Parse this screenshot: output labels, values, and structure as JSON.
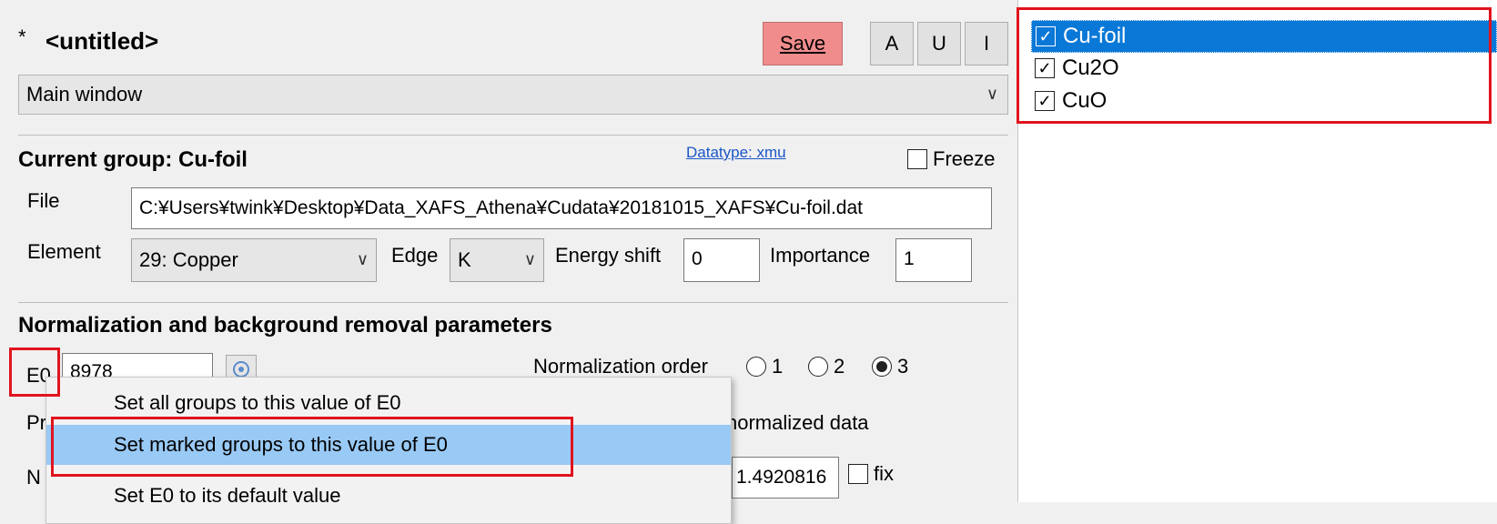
{
  "header": {
    "modified_mark": "*",
    "title": "<untitled>",
    "save_label": "Save",
    "btn_a": "A",
    "btn_u": "U",
    "btn_i": "I"
  },
  "main_select": {
    "value": "Main window"
  },
  "current_group": {
    "heading": "Current group:  Cu-foil",
    "datatype_link": "Datatype: xmu",
    "freeze_label": "Freeze",
    "file_label": "File",
    "file_path": "C:¥Users¥twink¥Desktop¥Data_XAFS_Athena¥Cudata¥20181015_XAFS¥Cu-foil.dat",
    "element_label": "Element",
    "element_value": "29: Copper",
    "edge_label": "Edge",
    "edge_value": "K",
    "energy_shift_label": "Energy shift",
    "energy_shift_value": "0",
    "importance_label": "Importance",
    "importance_value": "1"
  },
  "norm": {
    "heading": "Normalization and background removal parameters",
    "e0_label": "E0",
    "e0_value": "8978",
    "norm_order_label": "Normalization order",
    "order_options": [
      "1",
      "2",
      "3"
    ],
    "order_selected": "3",
    "pre_partial": "Pr",
    "normalized_partial": "normalized data",
    "n_partial": "N",
    "edge_step_value": "1.4920816",
    "fix_label": "fix"
  },
  "context_menu": {
    "items": [
      "Set all groups to this value of E0",
      "Set marked groups to this value of E0",
      "Set E0 to its default value"
    ]
  },
  "group_list": {
    "items": [
      {
        "label": "Cu-foil",
        "checked": true,
        "selected": true
      },
      {
        "label": "Cu2O",
        "checked": true,
        "selected": false
      },
      {
        "label": "CuO",
        "checked": true,
        "selected": false
      }
    ]
  },
  "colors": {
    "accent_red": "#e0141e",
    "selection_blue": "#0a78d7",
    "menu_highlight": "#99c9f5",
    "save_button": "#f08c8c"
  }
}
